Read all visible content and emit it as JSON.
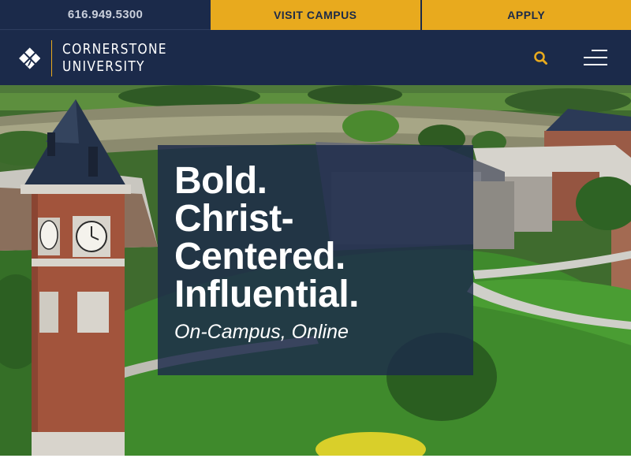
{
  "utility_bar": {
    "phone": "616.949.5300",
    "visit_campus_label": "VISIT CAMPUS",
    "apply_label": "APPLY"
  },
  "header": {
    "logo_line1": "CORNERSTONE",
    "logo_line2": "UNIVERSITY",
    "search_icon": "search-icon",
    "menu_icon": "hamburger-menu-icon"
  },
  "hero": {
    "headline_line1": "Bold.",
    "headline_line2": "Christ-",
    "headline_line3": "Centered.",
    "headline_line4": "Influential.",
    "subheading": "On-Campus, Online",
    "image": "aerial-campus-photo"
  },
  "colors": {
    "navy": "#1b2a4a",
    "gold": "#e8aa1e",
    "white": "#ffffff"
  }
}
